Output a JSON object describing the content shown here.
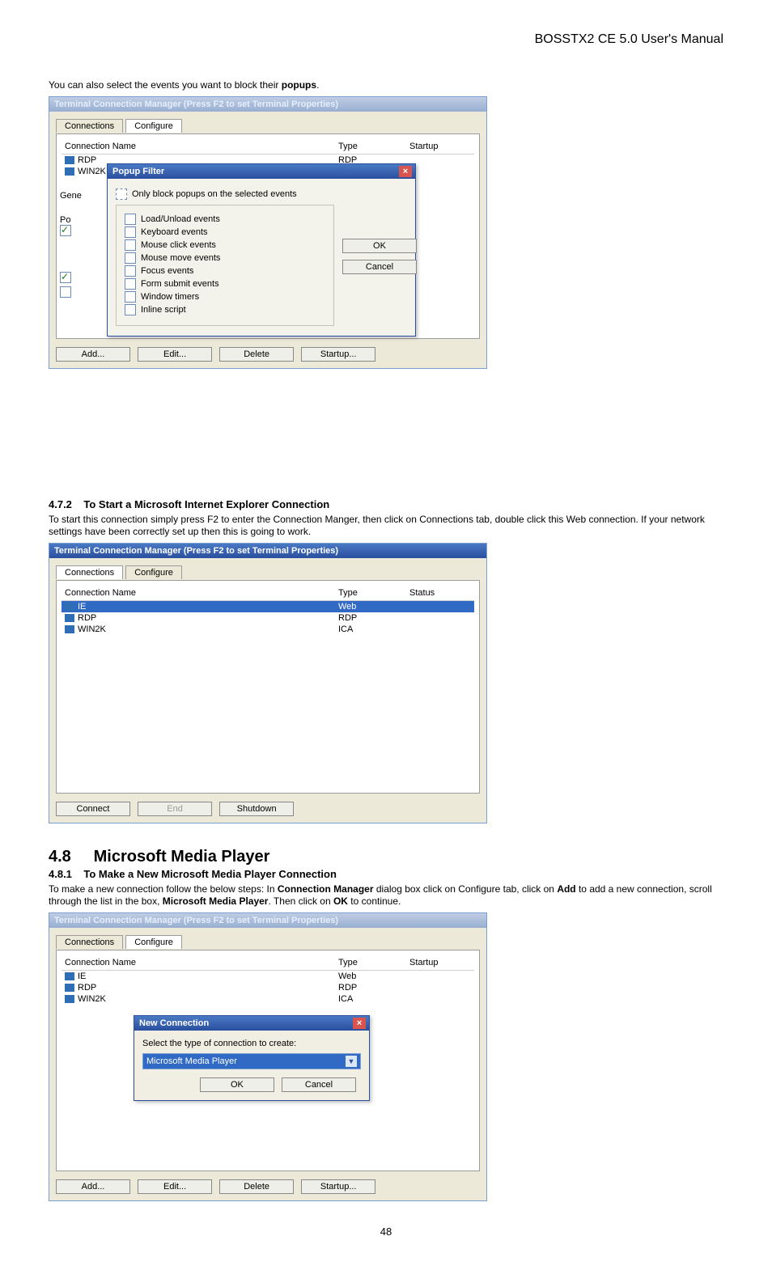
{
  "header": {
    "title": "BOSSTX2 CE 5.0 User's Manual"
  },
  "intro1_pre": "You can also select the events you want to block their ",
  "intro1_bold": "popups",
  "intro1_post": ".",
  "win1": {
    "title": "Terminal Connection Manager (Press F2 to set Terminal Properties)",
    "tabs": {
      "connections": "Connections",
      "configure": "Configure"
    },
    "cols": {
      "name": "Connection Name",
      "type": "Type",
      "startup": "Startup"
    },
    "rows": [
      {
        "name": "RDP",
        "type": "RDP"
      },
      {
        "name": "WIN2K",
        "type": ""
      }
    ],
    "left_labels": {
      "gene": "Gene",
      "po": "Po"
    },
    "popup": {
      "title": "Popup Filter",
      "only_block": "Only block popups on the selected events",
      "items": [
        "Load/Unload events",
        "Keyboard events",
        "Mouse click events",
        "Mouse move events",
        "Focus events",
        "Form submit events",
        "Window timers",
        "Inline script"
      ],
      "ok": "OK",
      "cancel": "Cancel"
    },
    "buttons": {
      "add": "Add...",
      "edit": "Edit...",
      "delete": "Delete",
      "startup": "Startup..."
    }
  },
  "sec472": {
    "num": "4.7.2",
    "title": "To Start a Microsoft Internet Explorer Connection",
    "para": "To start this connection simply press F2 to enter the Connection Manger, then click on Connections tab, double click this Web connection. If your network settings have been correctly set up then this is going to work."
  },
  "win2": {
    "title": "Terminal Connection Manager (Press F2 to set Terminal Properties)",
    "tabs": {
      "connections": "Connections",
      "configure": "Configure"
    },
    "cols": {
      "name": "Connection Name",
      "type": "Type",
      "status": "Status"
    },
    "rows": [
      {
        "name": "IE",
        "type": "Web",
        "selected": true
      },
      {
        "name": "RDP",
        "type": "RDP"
      },
      {
        "name": "WIN2K",
        "type": "ICA"
      }
    ],
    "buttons": {
      "connect": "Connect",
      "end": "End",
      "shutdown": "Shutdown"
    }
  },
  "sec48": {
    "num": "4.8",
    "title": "Microsoft Media Player"
  },
  "sec481": {
    "num": "4.8.1",
    "title": "To Make a New Microsoft Media Player Connection"
  },
  "para481_pre": "To make a new connection follow the below steps: In ",
  "para481_b1": "Connection Manager",
  "para481_mid1": " dialog box click on Configure tab, click on ",
  "para481_b2": "Add",
  "para481_mid2": " to add a new connection, scroll through the list in the box, ",
  "para481_b3": "Microsoft Media Player",
  "para481_mid3": ". Then click on ",
  "para481_b4": "OK",
  "para481_post": " to continue.",
  "win3": {
    "title": "Terminal Connection Manager (Press F2 to set Terminal Properties)",
    "tabs": {
      "connections": "Connections",
      "configure": "Configure"
    },
    "cols": {
      "name": "Connection Name",
      "type": "Type",
      "startup": "Startup"
    },
    "rows": [
      {
        "name": "IE",
        "type": "Web"
      },
      {
        "name": "RDP",
        "type": "RDP"
      },
      {
        "name": "WIN2K",
        "type": "ICA"
      }
    ],
    "newconn": {
      "title": "New Connection",
      "label": "Select the type of connection to create:",
      "value": "Microsoft Media Player",
      "ok": "OK",
      "cancel": "Cancel"
    },
    "buttons": {
      "add": "Add...",
      "edit": "Edit...",
      "delete": "Delete",
      "startup": "Startup..."
    }
  },
  "page_number": "48",
  "icons": {
    "close": "×",
    "down": "▼"
  }
}
